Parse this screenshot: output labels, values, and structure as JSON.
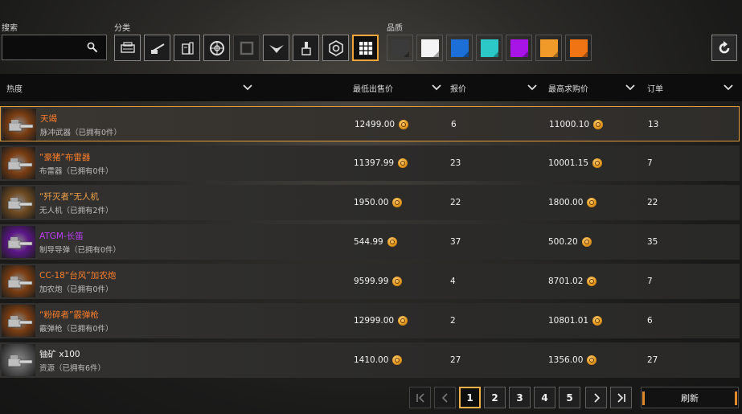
{
  "filters": {
    "search_label": "搜索",
    "search_value": "",
    "category_label": "分类",
    "quality_label": "品质",
    "categories": [
      {
        "name": "cabin-icon"
      },
      {
        "name": "cannon-icon"
      },
      {
        "name": "fuel-module-icon"
      },
      {
        "name": "wheel-icon"
      },
      {
        "name": "frame-icon"
      },
      {
        "name": "winged-emblem-icon"
      },
      {
        "name": "sticker-icon"
      },
      {
        "name": "paint-brush-icon"
      },
      {
        "name": "hex-nut-icon"
      },
      {
        "name": "all-grid-icon"
      }
    ],
    "qualities": [
      {
        "name": "quality-common",
        "color": "#3b3b3b"
      },
      {
        "name": "quality-white",
        "color": "#f4f4f4"
      },
      {
        "name": "quality-blue",
        "color": "#1b6fd6"
      },
      {
        "name": "quality-cyan",
        "color": "#2cc7c7"
      },
      {
        "name": "quality-purple",
        "color": "#a814e6"
      },
      {
        "name": "quality-orange",
        "color": "#f09a2a"
      },
      {
        "name": "quality-red-orange",
        "color": "#f07414"
      }
    ]
  },
  "table": {
    "columns": {
      "popularity": "热度",
      "lowest_sell": "最低出售价",
      "offers": "报价",
      "highest_buy": "最高求购价",
      "orders": "订单"
    },
    "rows": [
      {
        "name": "天竭",
        "type": "脉冲武器（已拥有0件）",
        "sell": "12499.00",
        "offers": "6",
        "buy": "11000.10",
        "orders": "13",
        "name_color": "#ff7f2a",
        "thumb_bg": "#7a3d12"
      },
      {
        "name": "“豪猪”布雷器",
        "type": "布雷器（已拥有0件）",
        "sell": "11397.99",
        "offers": "23",
        "buy": "10001.15",
        "orders": "7",
        "name_color": "#ff7f2a",
        "thumb_bg": "#7a3d12"
      },
      {
        "name": "“歼灭者”无人机",
        "type": "无人机（已拥有2件）",
        "sell": "1950.00",
        "offers": "22",
        "buy": "1800.00",
        "orders": "22",
        "name_color": "#f3a24a",
        "thumb_bg": "#6e4a22"
      },
      {
        "name": "ATGM-长笛",
        "type": "制导导弹（已拥有0件）",
        "sell": "544.99",
        "offers": "37",
        "buy": "500.20",
        "orders": "35",
        "name_color": "#c23cff",
        "thumb_bg": "#5b1587"
      },
      {
        "name": "CC-18“台风”加农炮",
        "type": "加农炮（已拥有0件）",
        "sell": "9599.99",
        "offers": "4",
        "buy": "8701.02",
        "orders": "7",
        "name_color": "#ff7f2a",
        "thumb_bg": "#7a3d12"
      },
      {
        "name": "“粉碎者”霰弹枪",
        "type": "霰弹枪（已拥有0件）",
        "sell": "12999.00",
        "offers": "2",
        "buy": "10801.01",
        "orders": "6",
        "name_color": "#ff7f2a",
        "thumb_bg": "#7a3d12"
      },
      {
        "name": "铀矿 x100",
        "type": "资源（已拥有6件）",
        "sell": "1410.00",
        "offers": "27",
        "buy": "1356.00",
        "orders": "27",
        "name_color": "#f2f2f2",
        "thumb_bg": "#5a5a5a"
      }
    ]
  },
  "pagination": {
    "pages": [
      "1",
      "2",
      "3",
      "4",
      "5"
    ],
    "current_page": "1",
    "refresh_label": "刷新"
  },
  "colors": {
    "accent": "#efb04a",
    "selected_border": "#e09a3c"
  }
}
